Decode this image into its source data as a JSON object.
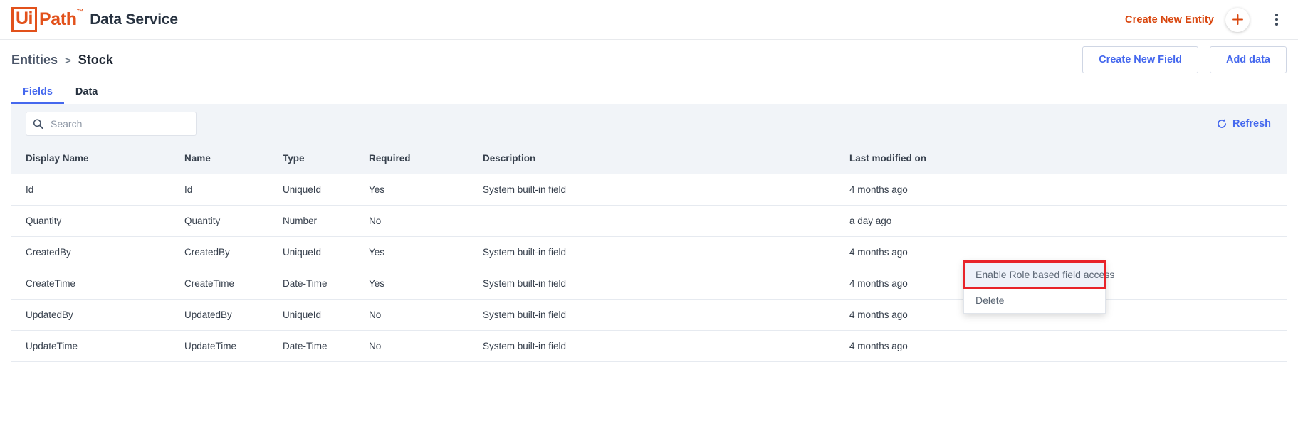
{
  "appbar": {
    "logo_ui": "Ui",
    "logo_path": "Path",
    "logo_tm": "™",
    "product": "Data Service",
    "create_entity_label": "Create New Entity",
    "plus_icon": "plus-icon",
    "kebab_icon": "more-vertical-icon",
    "accent_color": "#e2511b"
  },
  "page_head": {
    "breadcrumb": {
      "parent": "Entities",
      "separator": ">",
      "current": "Stock"
    },
    "actions": [
      {
        "label": "Create New Field"
      },
      {
        "label": "Add data"
      }
    ]
  },
  "tabs": [
    {
      "label": "Fields",
      "active": true
    },
    {
      "label": "Data",
      "active": false
    }
  ],
  "toolbar": {
    "search_placeholder": "Search",
    "search_value": "",
    "search_icon": "search-icon",
    "refresh_label": "Refresh",
    "refresh_icon": "refresh-icon",
    "link_color": "#4568ee"
  },
  "table": {
    "columns": [
      "Display Name",
      "Name",
      "Type",
      "Required",
      "Description",
      "Last modified on"
    ],
    "rows": [
      {
        "display_name": "Id",
        "name": "Id",
        "type": "UniqueId",
        "required": "Yes",
        "description": "System built-in field",
        "last_modified": "4 months ago"
      },
      {
        "display_name": "Quantity",
        "name": "Quantity",
        "type": "Number",
        "required": "No",
        "description": "",
        "last_modified": "a day ago"
      },
      {
        "display_name": "CreatedBy",
        "name": "CreatedBy",
        "type": "UniqueId",
        "required": "Yes",
        "description": "System built-in field",
        "last_modified": "4 months ago"
      },
      {
        "display_name": "CreateTime",
        "name": "CreateTime",
        "type": "Date-Time",
        "required": "Yes",
        "description": "System built-in field",
        "last_modified": "4 months ago"
      },
      {
        "display_name": "UpdatedBy",
        "name": "UpdatedBy",
        "type": "UniqueId",
        "required": "No",
        "description": "System built-in field",
        "last_modified": "4 months ago"
      },
      {
        "display_name": "UpdateTime",
        "name": "UpdateTime",
        "type": "Date-Time",
        "required": "No",
        "description": "System built-in field",
        "last_modified": "4 months ago"
      }
    ]
  },
  "context_menu": {
    "items": [
      {
        "label": "Enable Role based field access",
        "highlighted": true
      },
      {
        "label": "Delete",
        "highlighted": false
      }
    ],
    "highlight_outline_color": "#e8232a"
  }
}
